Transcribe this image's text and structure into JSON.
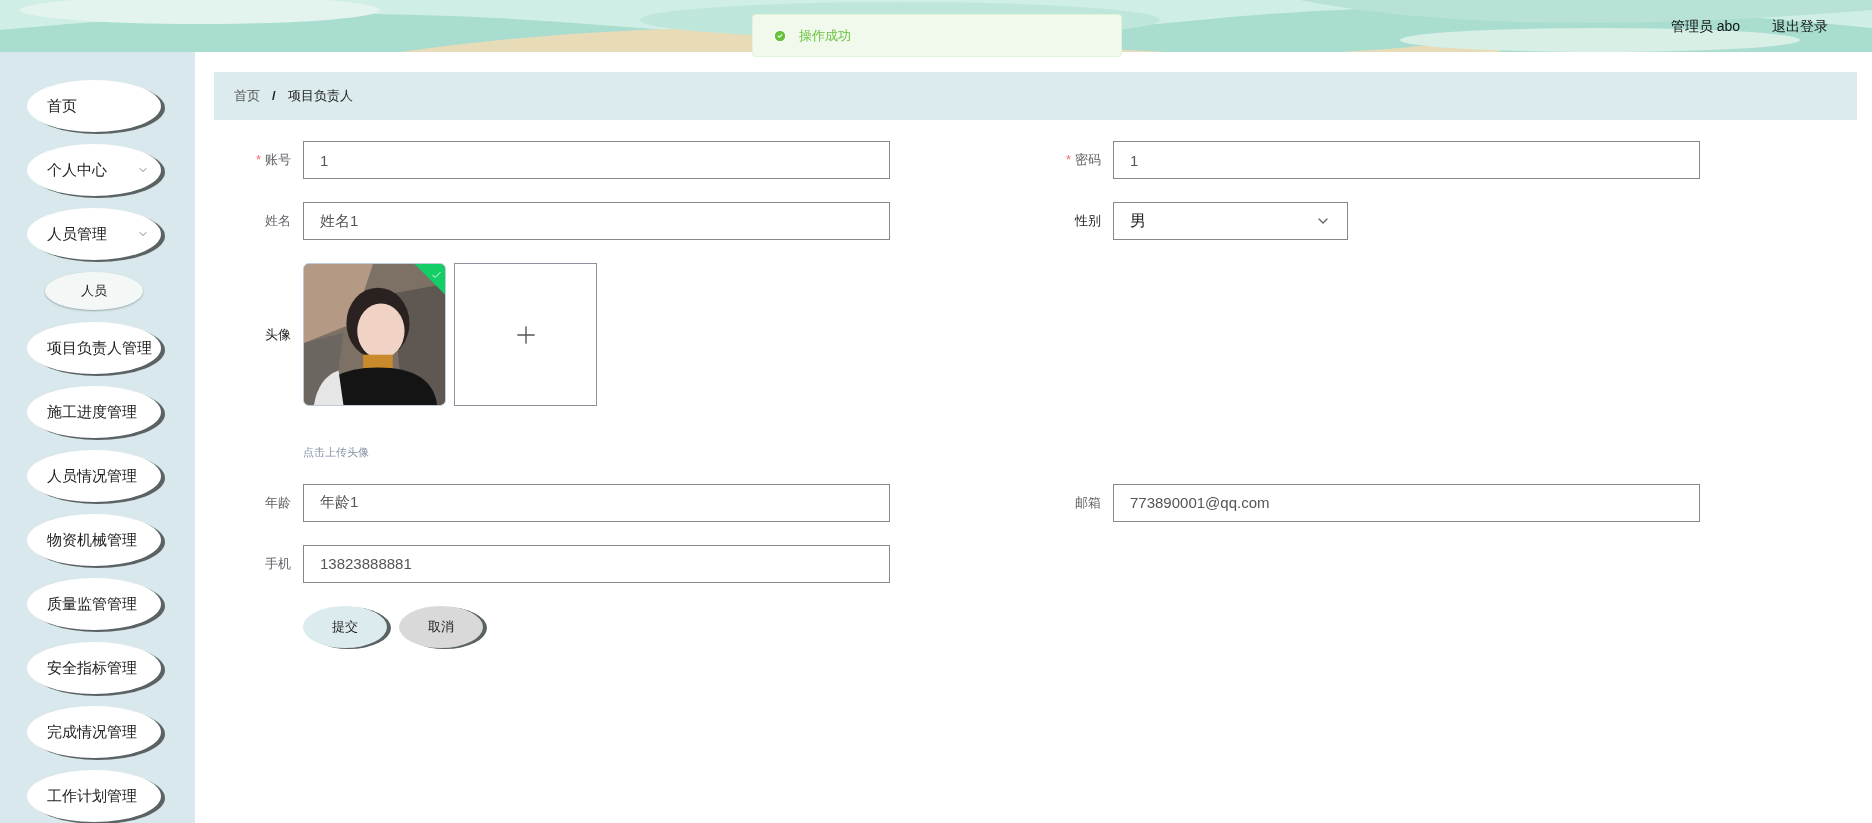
{
  "header": {
    "user_label": "管理员 abo",
    "logout": "退出登录"
  },
  "toast": {
    "kind": "success",
    "message": "操作成功"
  },
  "sidebar": {
    "items": [
      {
        "label": "首页",
        "kind": "link"
      },
      {
        "label": "个人中心",
        "kind": "submenu"
      },
      {
        "label": "人员管理",
        "kind": "submenu",
        "children": [
          {
            "label": "人员"
          }
        ]
      },
      {
        "label": "项目负责人管理",
        "kind": "link"
      },
      {
        "label": "施工进度管理",
        "kind": "link"
      },
      {
        "label": "人员情况管理",
        "kind": "link"
      },
      {
        "label": "物资机械管理",
        "kind": "link"
      },
      {
        "label": "质量监管管理",
        "kind": "link"
      },
      {
        "label": "安全指标管理",
        "kind": "link"
      },
      {
        "label": "完成情况管理",
        "kind": "link"
      },
      {
        "label": "工作计划管理",
        "kind": "link"
      }
    ]
  },
  "breadcrumb": {
    "separator": "/",
    "items": [
      "首页",
      "项目负责人"
    ]
  },
  "form": {
    "rows": [
      [
        {
          "label": "账号",
          "required_mark": "*",
          "kind": "input",
          "value": "1"
        },
        {
          "label": "密码",
          "required_mark": "*",
          "kind": "input",
          "value": "1"
        }
      ],
      [
        {
          "label": "姓名",
          "kind": "input",
          "value": "姓名1"
        },
        {
          "label": "性别",
          "kind": "select",
          "value": "男"
        }
      ],
      [
        {
          "label": "头像",
          "kind": "upload",
          "uploaded": true,
          "hint": "点击上传头像"
        }
      ],
      [
        {
          "label": "年龄",
          "kind": "input",
          "value": "年龄1"
        },
        {
          "label": "邮箱",
          "kind": "input",
          "value": "773890001@qq.com"
        }
      ],
      [
        {
          "label": "手机",
          "kind": "input",
          "value": "13823888881"
        }
      ]
    ],
    "buttons": [
      {
        "label": "提交",
        "kind": "primary"
      },
      {
        "label": "取消",
        "kind": "default"
      }
    ]
  }
}
